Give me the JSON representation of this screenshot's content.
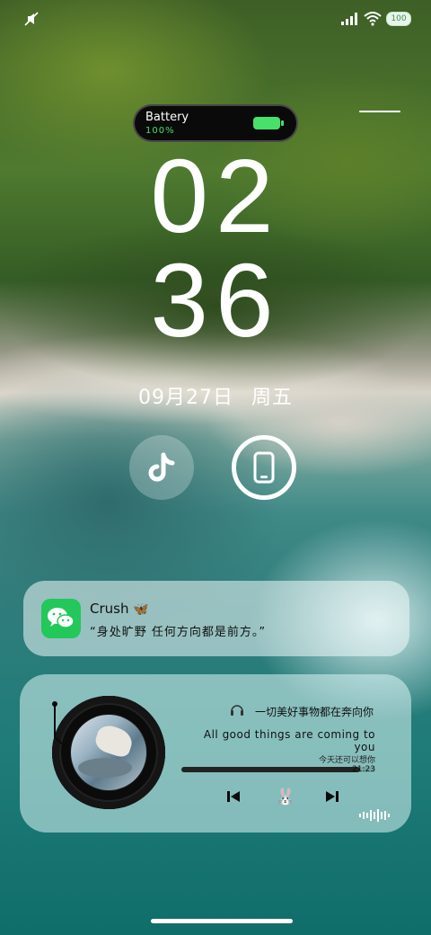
{
  "status_bar": {
    "battery_level": "100",
    "icons": [
      "mute-icon",
      "signal-icon",
      "wifi-icon",
      "battery-icon"
    ]
  },
  "battery_widget": {
    "label": "Battery",
    "percent": "100%"
  },
  "clock": {
    "hour": "02",
    "minute": "36"
  },
  "date": {
    "day": "09月27日",
    "weekday": "周五"
  },
  "shortcuts": [
    "tiktok-icon",
    "phone-icon"
  ],
  "notification": {
    "title": "Crush",
    "title_emoji": "🦋",
    "message": "“身处旷野 任何方向都是前方。”"
  },
  "music_widget": {
    "title": "一切美好事物都在奔向你",
    "lyric": "All good things are coming to you",
    "next_lyric": "今天还可以想你",
    "time": "21:23",
    "progress": 0.92,
    "center_emoji": "🐰"
  },
  "colors": {
    "battery_green": "#47e06a",
    "wechat_green": "#22c85a"
  }
}
